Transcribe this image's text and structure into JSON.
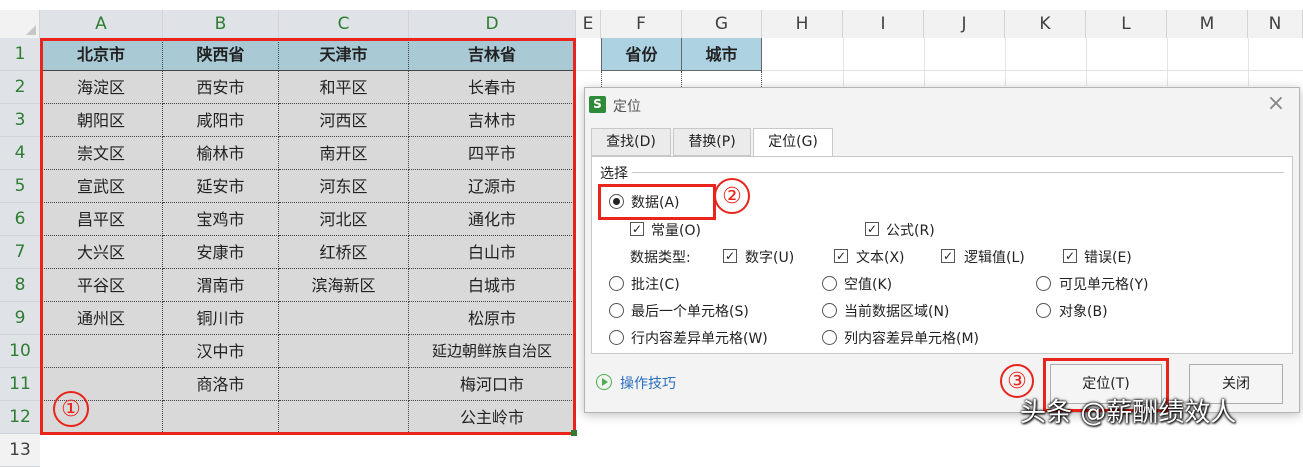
{
  "columns": [
    "A",
    "B",
    "C",
    "D",
    "E",
    "F",
    "G",
    "H",
    "I",
    "J",
    "K",
    "L",
    "M",
    "N"
  ],
  "rows": [
    "1",
    "2",
    "3",
    "4",
    "5",
    "6",
    "7",
    "8",
    "9",
    "10",
    "11",
    "12",
    "13"
  ],
  "table": {
    "headers": [
      "北京市",
      "陕西省",
      "天津市",
      "吉林省"
    ],
    "rows": [
      [
        "海淀区",
        "西安市",
        "和平区",
        "长春市"
      ],
      [
        "朝阳区",
        "咸阳市",
        "河西区",
        "吉林市"
      ],
      [
        "崇文区",
        "榆林市",
        "南开区",
        "四平市"
      ],
      [
        "宣武区",
        "延安市",
        "河东区",
        "辽源市"
      ],
      [
        "昌平区",
        "宝鸡市",
        "河北区",
        "通化市"
      ],
      [
        "大兴区",
        "安康市",
        "红桥区",
        "白山市"
      ],
      [
        "平谷区",
        "渭南市",
        "滨海新区",
        "白城市"
      ],
      [
        "通州区",
        "铜川市",
        "",
        "松原市"
      ],
      [
        "",
        "汉中市",
        "",
        "延边朝鲜族自治区"
      ],
      [
        "",
        "商洛市",
        "",
        "梅河口市"
      ],
      [
        "",
        "",
        "",
        "公主岭市"
      ]
    ]
  },
  "side_table": {
    "headers": [
      "省份",
      "城市"
    ]
  },
  "annotations": {
    "one": "①",
    "two": "②",
    "three": "③"
  },
  "dialog": {
    "app_icon": "S",
    "title": "定位",
    "close": "×",
    "tabs": [
      "查找(D)",
      "替换(P)",
      "定位(G)"
    ],
    "group_label": "选择",
    "data_option": "数据(A)",
    "constant": "常量(O)",
    "formula": "公式(R)",
    "data_type_label": "数据类型:",
    "types": [
      "数字(U)",
      "文本(X)",
      "逻辑值(L)",
      "错误(E)"
    ],
    "options": [
      "批注(C)",
      "空值(K)",
      "可见单元格(Y)",
      "最后一个单元格(S)",
      "当前数据区域(N)",
      "对象(B)",
      "行内容差异单元格(W)",
      "列内容差异单元格(M)"
    ],
    "tips": "操作技巧",
    "locate_button": "定位(T)",
    "close_button": "关闭"
  },
  "watermark": "头条 @薪酬绩效人"
}
